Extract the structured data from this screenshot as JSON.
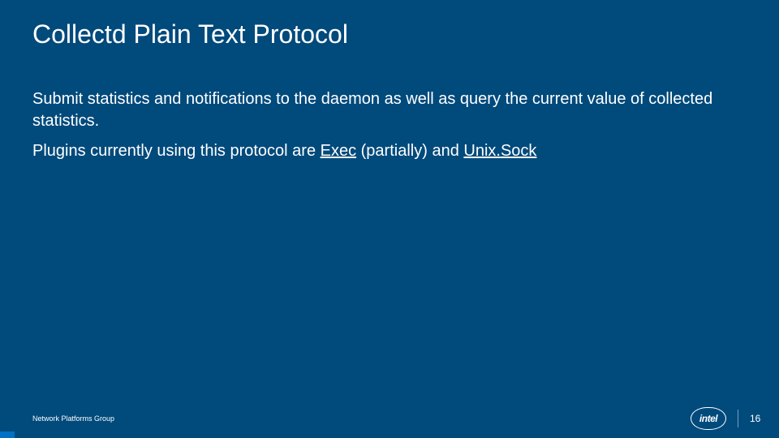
{
  "title": "Collectd Plain Text Protocol",
  "body": {
    "p1": "Submit statistics and notifications to the daemon as well as query the current value of collected statistics.",
    "p2_prefix": "Plugins currently using this protocol are ",
    "link1": "Exec",
    "p2_mid": " (partially) and ",
    "link2": "Unix.Sock"
  },
  "footer": {
    "group": "Network Platforms Group",
    "logo_text": "intel",
    "page": "16"
  }
}
